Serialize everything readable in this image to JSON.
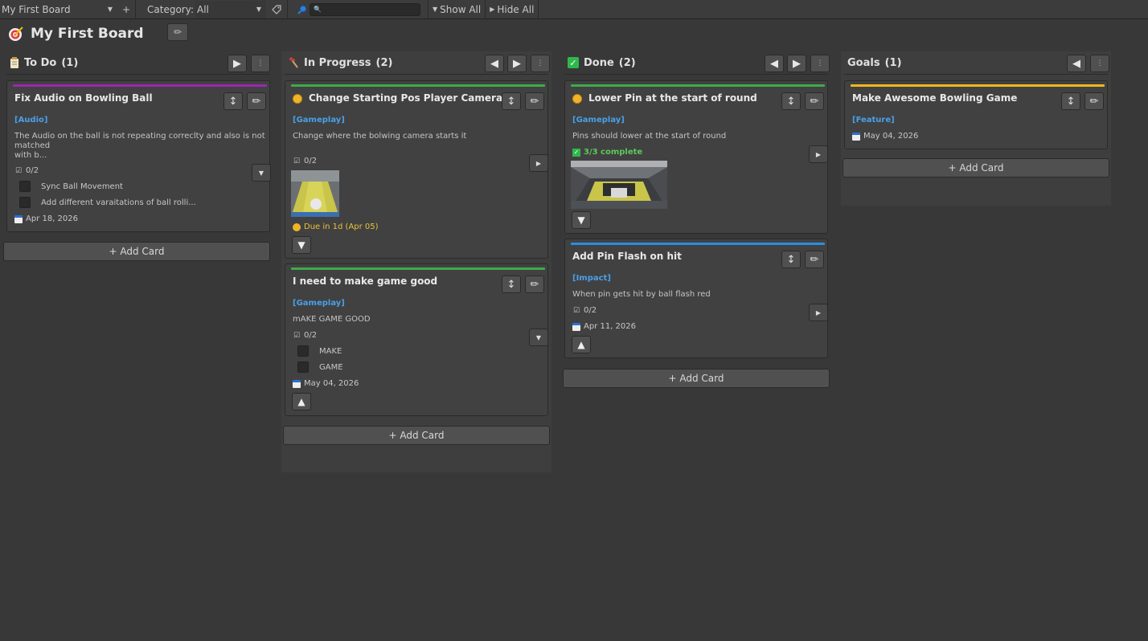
{
  "toolbar": {
    "board_select": "My First Board",
    "add_board": "+",
    "category_label": "Category:",
    "category_value": "All",
    "show_all": "Show All",
    "hide_all": "Hide All"
  },
  "board": {
    "title": "My First Board"
  },
  "columns": [
    {
      "title": "To Do",
      "count": "(1)",
      "cards": [
        {
          "title": "Fix Audio on Bowling Ball",
          "stripe_color": "#9b27b0",
          "tag": "[Audio]",
          "desc_line1": "The Audio on the ball is not repeating correclty and also is not",
          "desc_line2": "matched",
          "desc_line3": "with b...",
          "progress": "0/2",
          "checklist": [
            "Sync Ball Movement",
            "Add different varaitations of ball rolli..."
          ],
          "date": "Apr 18, 2026"
        }
      ],
      "add_card": "+ Add Card"
    },
    {
      "title": "In Progress",
      "count": "(2)",
      "cards": [
        {
          "title": "Change Starting Pos Player Camera",
          "stripe_color": "#3dab4a",
          "tag": "[Gameplay]",
          "desc": "Change where the bolwing camera starts it",
          "progress": "0/2",
          "due": "Due in 1d (Apr 05)"
        },
        {
          "title": "I need to make game good",
          "stripe_color": "#3dab4a",
          "tag": "[Gameplay]",
          "desc": "mAKE GAME GOOD",
          "progress": "0/2",
          "checklist": [
            "MAKE",
            "GAME"
          ],
          "date": "May 04, 2026"
        }
      ],
      "add_card": "+ Add Card"
    },
    {
      "title": "Done",
      "count": "(2)",
      "cards": [
        {
          "title": "Lower Pin at the start of round",
          "stripe_color": "#3dab4a",
          "tag": "[Gameplay]",
          "desc": "Pins should lower at the start of round",
          "complete": "3/3 complete"
        },
        {
          "title": "Add Pin Flash on hit",
          "stripe_color": "#2a8ee0",
          "tag": "[Impact]",
          "desc": "When pin gets hit by ball flash red",
          "progress": "0/2",
          "date": "Apr 11, 2026"
        }
      ],
      "add_card": "+ Add Card"
    },
    {
      "title": "Goals",
      "count": "(1)",
      "cards": [
        {
          "title": "Make Awesome Bowling Game",
          "stripe_color": "#f2b81c",
          "tag": "[Feature]",
          "date": "May 04, 2026"
        }
      ],
      "add_card": "+ Add Card"
    }
  ],
  "colors": {
    "background": "#383838",
    "tag": "#4aa0e8",
    "due": "#e8c33a",
    "complete": "#5cc95c"
  }
}
